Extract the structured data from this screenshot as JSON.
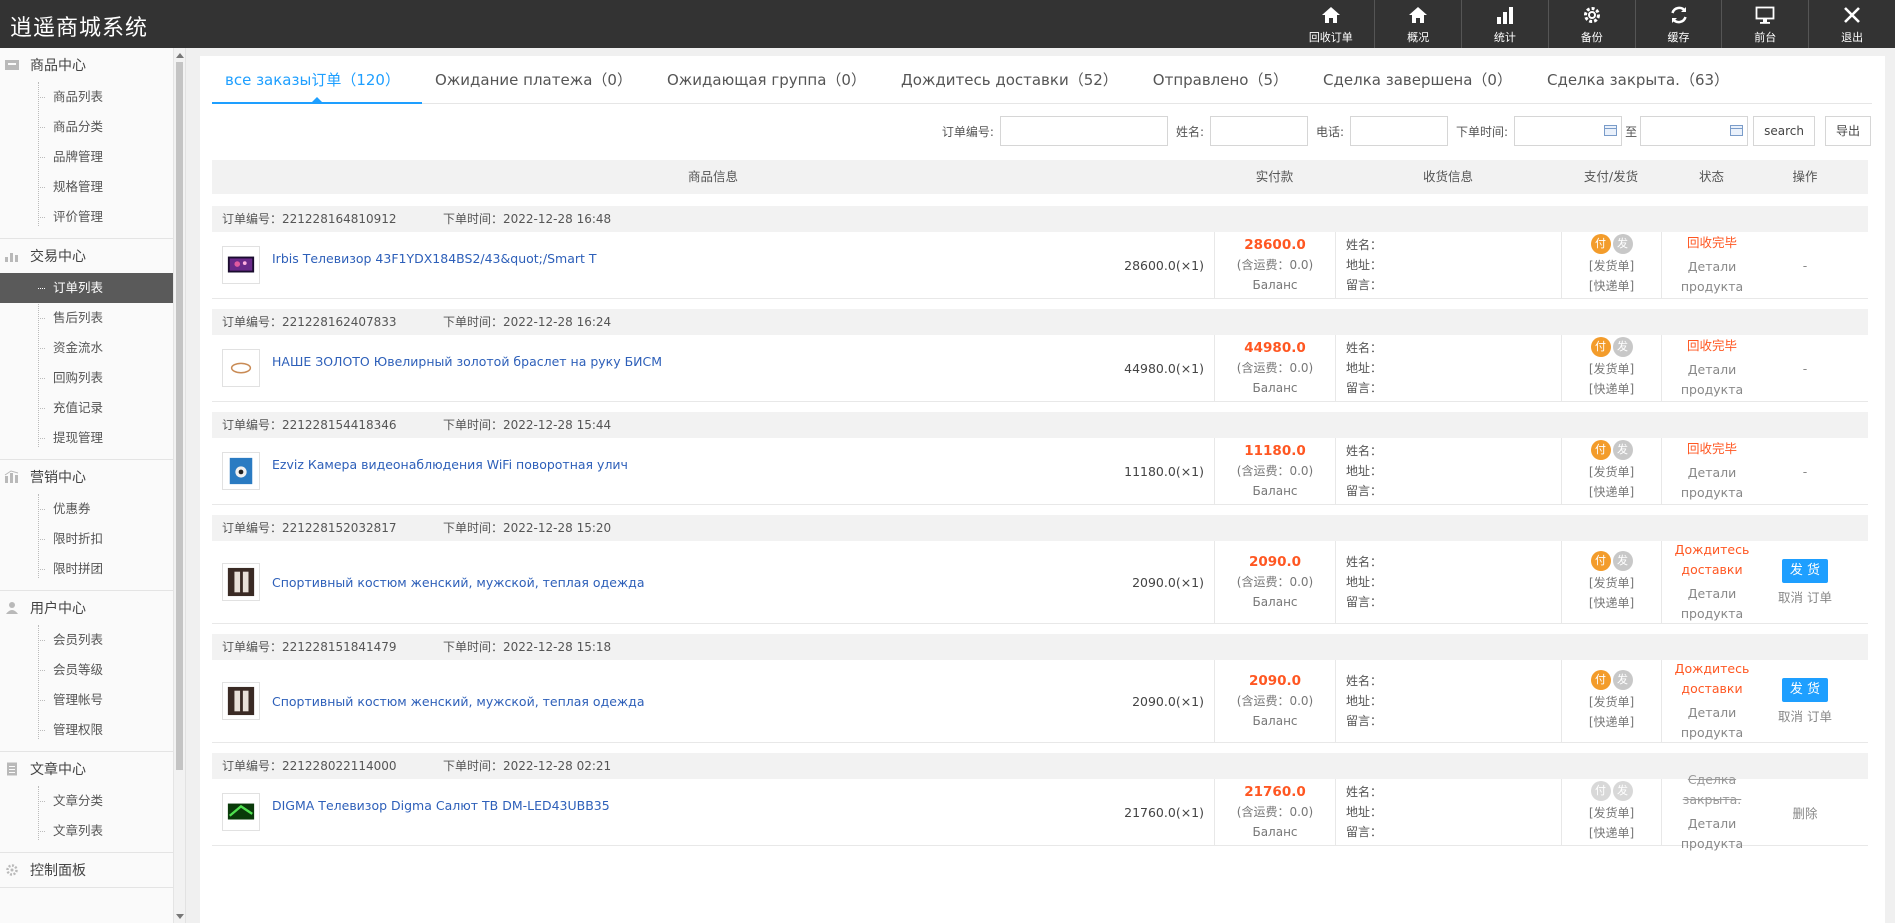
{
  "app": {
    "title": "逍遥商城系统"
  },
  "toolbar": [
    {
      "label": "回收订单",
      "icon": "home-icon"
    },
    {
      "label": "概况",
      "icon": "home-icon"
    },
    {
      "label": "统计",
      "icon": "bar-chart-icon"
    },
    {
      "label": "备份",
      "icon": "gear-icon"
    },
    {
      "label": "缓存",
      "icon": "refresh-icon"
    },
    {
      "label": "前台",
      "icon": "monitor-icon"
    },
    {
      "label": "退出",
      "icon": "close-icon"
    }
  ],
  "sidebar": {
    "groups": [
      {
        "title": "商品中心",
        "icon": "inbox-icon",
        "items": [
          "商品列表",
          "商品分类",
          "品牌管理",
          "规格管理",
          "评价管理"
        ]
      },
      {
        "title": "交易中心",
        "icon": "bar-chart-icon",
        "items": [
          "订单列表",
          "售后列表",
          "资金流水",
          "回购列表",
          "充值记录",
          "提现管理"
        ],
        "active": 0
      },
      {
        "title": "营销中心",
        "icon": "stats-icon",
        "items": [
          "优惠券",
          "限时折扣",
          "限时拼团"
        ]
      },
      {
        "title": "用户中心",
        "icon": "user-icon",
        "items": [
          "会员列表",
          "会员等级",
          "管理帐号",
          "管理权限"
        ]
      },
      {
        "title": "文章中心",
        "icon": "document-icon",
        "items": [
          "文章分类",
          "文章列表"
        ]
      },
      {
        "title": "控制面板",
        "icon": "gear-icon",
        "items": []
      }
    ]
  },
  "tabs": [
    {
      "label": "все заказы订单（120）",
      "active": true
    },
    {
      "label": "Ожидание платежа（0）"
    },
    {
      "label": "Ожидающая группа（0）"
    },
    {
      "label": "Дождитесь доставки（52）"
    },
    {
      "label": "Отправлено（5）"
    },
    {
      "label": "Сделка завершена（0）"
    },
    {
      "label": "Сделка закрыта.（63）"
    }
  ],
  "filter": {
    "order_no_label": "订单编号:",
    "name_label": "姓名:",
    "phone_label": "电话:",
    "time_label": "下单时间:",
    "to_label": "至",
    "search_label": "search",
    "export_label": "导出"
  },
  "table": {
    "headers": {
      "product": "商品信息",
      "paid": "实付款",
      "receiver": "收货信息",
      "payship": "支付/发货",
      "status": "状态",
      "operation": "操作"
    }
  },
  "labels": {
    "order_no": "订单编号：",
    "order_time": "下单时间：",
    "shipping_fee": "(含运费：0.0)",
    "balance": "Баланс",
    "name": "姓名：",
    "address": "地址：",
    "message": "留言：",
    "pay_badge": "付",
    "ship_badge": "发",
    "invoice": "[发货单]",
    "express": "[快递单]",
    "details": "Детали продукта",
    "ship_button": "发 货",
    "cancel_order": "取消 订单",
    "delete": "删除",
    "dash": "-"
  },
  "orders": [
    {
      "no": "221228164810912",
      "time": "2022-12-28 16:48",
      "product": "Irbis Телевизор 43F1YDX184BS2/43&quot;/Smart T",
      "price": "28600.0(×1)",
      "paid": "28600.0",
      "status": "回收完毕",
      "status_style": "orange",
      "paid_flag": true,
      "op": "dash",
      "thumb": "tv"
    },
    {
      "no": "221228162407833",
      "time": "2022-12-28 16:24",
      "product": "НАШЕ ЗОЛОТО Ювелирный золотой браслет на руку БИСМ",
      "price": "44980.0(×1)",
      "paid": "44980.0",
      "status": "回收完毕",
      "status_style": "orange",
      "paid_flag": true,
      "op": "dash",
      "thumb": "bracelet"
    },
    {
      "no": "221228154418346",
      "time": "2022-12-28 15:44",
      "product": "Ezviz Камера видеонаблюдения WiFi поворотная улич",
      "price": "11180.0(×1)",
      "paid": "11180.0",
      "status": "回收完毕",
      "status_style": "orange",
      "paid_flag": true,
      "op": "dash",
      "thumb": "camera"
    },
    {
      "no": "221228152032817",
      "time": "2022-12-28 15:20",
      "product": "Спортивный костюм женский, мужской, теплая одежда",
      "price": "2090.0(×1)",
      "paid": "2090.0",
      "status": "Дождитесь доставки",
      "status_style": "orange",
      "paid_flag": true,
      "op": "ship",
      "thumb": "suit"
    },
    {
      "no": "221228151841479",
      "time": "2022-12-28 15:18",
      "product": "Спортивный костюм женский, мужской, теплая одежда",
      "price": "2090.0(×1)",
      "paid": "2090.0",
      "status": "Дождитесь доставки",
      "status_style": "orange",
      "paid_flag": true,
      "op": "ship",
      "thumb": "suit"
    },
    {
      "no": "221228022114000",
      "time": "2022-12-28 02:21",
      "product": "DIGMA Телевизор Digma Салют ТВ DM-LED43UBB35",
      "price": "21760.0(×1)",
      "paid": "21760.0",
      "status": "Сделка закрыта.",
      "status_style": "struck",
      "paid_flag": false,
      "op": "delete",
      "thumb": "tv2"
    }
  ],
  "colors": {
    "accent": "#1e9fff",
    "price": "#ff5722",
    "topbar": "#333333",
    "link": "#2d5fb9"
  }
}
